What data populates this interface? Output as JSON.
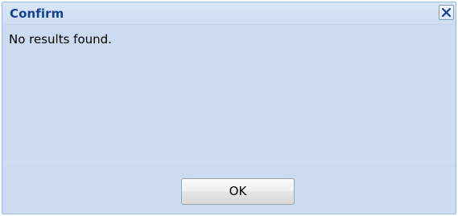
{
  "dialog": {
    "title": "Confirm",
    "message": "No results found.",
    "ok_label": "OK",
    "close_icon": "close-icon"
  },
  "colors": {
    "title_text": "#15428b",
    "dialog_background": "#cddbf0",
    "border": "#99bbe8",
    "close_icon": "#15428b"
  }
}
